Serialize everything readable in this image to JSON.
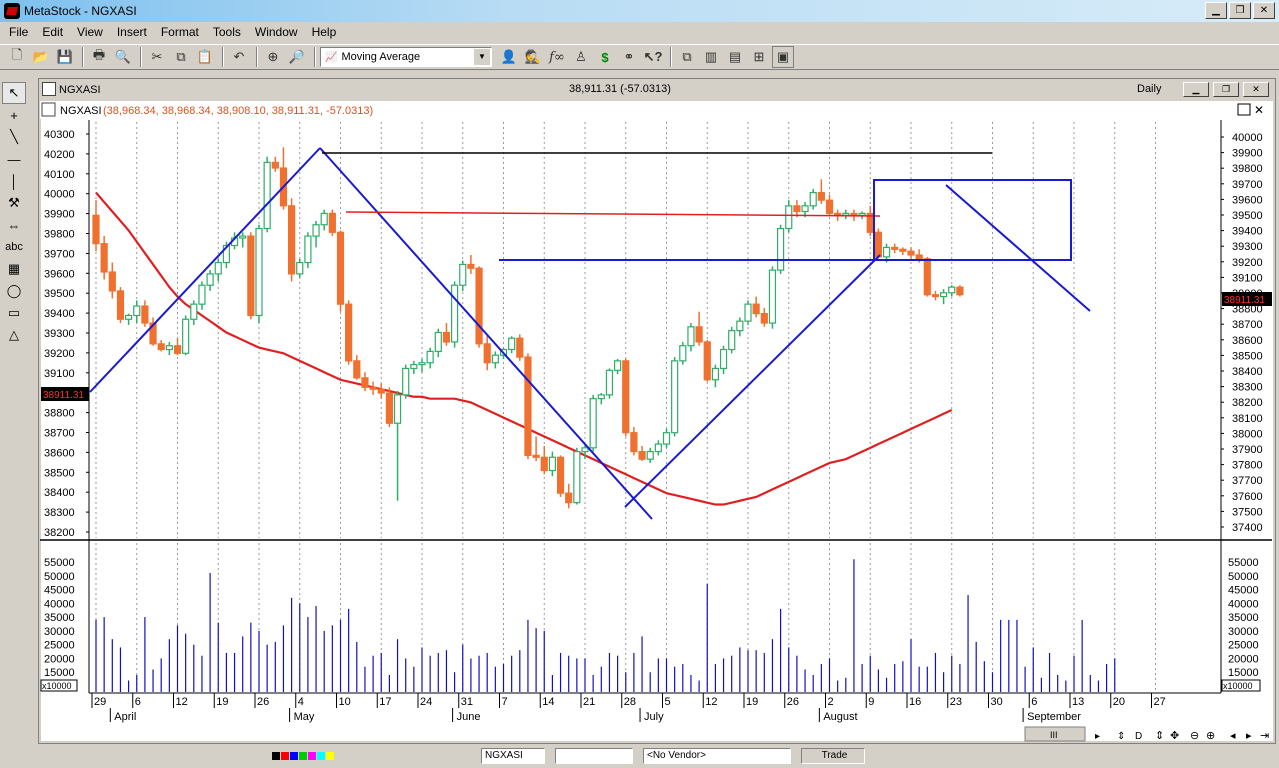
{
  "app": {
    "title": "MetaStock - NGXASI"
  },
  "menu": [
    "File",
    "Edit",
    "View",
    "Insert",
    "Format",
    "Tools",
    "Window",
    "Help"
  ],
  "toolbar": {
    "indicator_select": "Moving Average"
  },
  "left_tools": [
    "abc"
  ],
  "chart_window": {
    "ticker": "NGXASI",
    "quote": "38,911.31 (-57.0313)",
    "periodicity": "Daily",
    "header_label": "NGXASI",
    "header_values": "(38,968.34, 38,968.34, 38,908.10, 38,911.31, -57.0313)",
    "last_left": "38911.31",
    "last_right": "38911.31",
    "volume_multiplier": "x10000"
  },
  "chart_data": {
    "type": "candlestick",
    "left_axis_ticks": [
      40300,
      40200,
      40100,
      40000,
      39900,
      39800,
      39700,
      39600,
      39500,
      39400,
      39300,
      39200,
      39100,
      39000,
      38800,
      38700,
      38600,
      38500,
      38400,
      38300,
      38200
    ],
    "right_axis_ticks": [
      40000,
      39900,
      39800,
      39700,
      39600,
      39500,
      39400,
      39300,
      39200,
      39100,
      39000,
      38800,
      38700,
      38600,
      38500,
      38400,
      38300,
      38200,
      38100,
      38000,
      37900,
      37800,
      37700,
      37600,
      37500,
      37400
    ],
    "left_ylim": [
      38200,
      40300
    ],
    "volume_ticks": [
      55000,
      50000,
      45000,
      40000,
      35000,
      30000,
      25000,
      20000,
      15000,
      10000
    ],
    "volume_ylim": [
      10000,
      55000
    ],
    "x_ticks": [
      {
        "label": "29",
        "i": 0
      },
      {
        "label": "6",
        "i": 5
      },
      {
        "label": "12",
        "i": 10
      },
      {
        "label": "19",
        "i": 15
      },
      {
        "label": "26",
        "i": 20
      },
      {
        "label": "4",
        "i": 25
      },
      {
        "label": "10",
        "i": 30
      },
      {
        "label": "17",
        "i": 35
      },
      {
        "label": "24",
        "i": 40
      },
      {
        "label": "31",
        "i": 45
      },
      {
        "label": "7",
        "i": 50
      },
      {
        "label": "14",
        "i": 55
      },
      {
        "label": "21",
        "i": 60
      },
      {
        "label": "28",
        "i": 65
      },
      {
        "label": "5",
        "i": 70
      },
      {
        "label": "12",
        "i": 75
      },
      {
        "label": "19",
        "i": 80
      },
      {
        "label": "26",
        "i": 85
      },
      {
        "label": "2",
        "i": 90
      },
      {
        "label": "9",
        "i": 95
      },
      {
        "label": "16",
        "i": 100
      },
      {
        "label": "23",
        "i": 105
      },
      {
        "label": "30",
        "i": 110
      },
      {
        "label": "6",
        "i": 115
      },
      {
        "label": "13",
        "i": 120
      },
      {
        "label": "20",
        "i": 125
      },
      {
        "label": "27",
        "i": 130
      }
    ],
    "months": [
      {
        "label": "April",
        "i": 2
      },
      {
        "label": "May",
        "i": 24
      },
      {
        "label": "June",
        "i": 44
      },
      {
        "label": "July",
        "i": 67
      },
      {
        "label": "August",
        "i": 89
      },
      {
        "label": "September",
        "i": 114
      }
    ],
    "candles": [
      [
        39870,
        39950,
        39680,
        39720
      ],
      [
        39720,
        39760,
        39530,
        39570
      ],
      [
        39570,
        39620,
        39430,
        39470
      ],
      [
        39470,
        39490,
        39300,
        39320
      ],
      [
        39320,
        39350,
        39290,
        39340
      ],
      [
        39340,
        39420,
        39300,
        39390
      ],
      [
        39390,
        39420,
        39280,
        39300
      ],
      [
        39300,
        39330,
        39180,
        39190
      ],
      [
        39190,
        39210,
        39150,
        39160
      ],
      [
        39160,
        39200,
        39130,
        39180
      ],
      [
        39180,
        39220,
        39130,
        39140
      ],
      [
        39140,
        39340,
        39130,
        39320
      ],
      [
        39320,
        39420,
        39290,
        39400
      ],
      [
        39400,
        39520,
        39370,
        39500
      ],
      [
        39500,
        39580,
        39470,
        39560
      ],
      [
        39560,
        39640,
        39520,
        39620
      ],
      [
        39620,
        39730,
        39590,
        39710
      ],
      [
        39710,
        39780,
        39690,
        39750
      ],
      [
        39750,
        39780,
        39700,
        39760
      ],
      [
        39760,
        39780,
        39320,
        39340
      ],
      [
        39340,
        39820,
        39300,
        39800
      ],
      [
        39800,
        40180,
        39780,
        40150
      ],
      [
        40150,
        40180,
        40100,
        40120
      ],
      [
        40120,
        40230,
        39900,
        39920
      ],
      [
        39920,
        39960,
        39520,
        39560
      ],
      [
        39560,
        39640,
        39540,
        39620
      ],
      [
        39620,
        39780,
        39590,
        39760
      ],
      [
        39760,
        39840,
        39700,
        39820
      ],
      [
        39820,
        39900,
        39790,
        39880
      ],
      [
        39880,
        39900,
        39760,
        39780
      ],
      [
        39780,
        39790,
        39360,
        39400
      ],
      [
        39400,
        39420,
        39080,
        39100
      ],
      [
        39100,
        39130,
        39000,
        39010
      ],
      [
        39010,
        39040,
        38940,
        38960
      ],
      [
        38960,
        38990,
        38920,
        38950
      ],
      [
        38950,
        38980,
        38900,
        38930
      ],
      [
        38930,
        38960,
        38750,
        38770
      ],
      [
        38770,
        38940,
        38360,
        38920
      ],
      [
        38920,
        39080,
        38900,
        39060
      ],
      [
        39060,
        39100,
        39030,
        39080
      ],
      [
        39080,
        39110,
        39040,
        39090
      ],
      [
        39090,
        39170,
        39060,
        39150
      ],
      [
        39150,
        39270,
        39120,
        39250
      ],
      [
        39250,
        39300,
        39180,
        39200
      ],
      [
        39200,
        39520,
        39170,
        39500
      ],
      [
        39500,
        39630,
        39470,
        39610
      ],
      [
        39610,
        39660,
        39560,
        39590
      ],
      [
        39590,
        39600,
        39170,
        39190
      ],
      [
        39190,
        39230,
        39050,
        39090
      ],
      [
        39090,
        39150,
        39060,
        39130
      ],
      [
        39130,
        39170,
        39110,
        39160
      ],
      [
        39160,
        39230,
        39140,
        39220
      ],
      [
        39220,
        39240,
        39100,
        39120
      ],
      [
        39120,
        39140,
        38580,
        38600
      ],
      [
        38600,
        38700,
        38570,
        38590
      ],
      [
        38590,
        38650,
        38500,
        38520
      ],
      [
        38520,
        38620,
        38490,
        38590
      ],
      [
        38590,
        38600,
        38380,
        38400
      ],
      [
        38400,
        38450,
        38320,
        38350
      ],
      [
        38350,
        38640,
        38340,
        38620
      ],
      [
        38620,
        38660,
        38580,
        38640
      ],
      [
        38640,
        38920,
        38620,
        38900
      ],
      [
        38900,
        38930,
        38870,
        38920
      ],
      [
        38920,
        39060,
        38900,
        39050
      ],
      [
        39050,
        39110,
        39030,
        39100
      ],
      [
        39100,
        39110,
        38700,
        38720
      ],
      [
        38720,
        38750,
        38600,
        38620
      ],
      [
        38620,
        38650,
        38570,
        38580
      ],
      [
        38580,
        38640,
        38560,
        38620
      ],
      [
        38620,
        38680,
        38600,
        38660
      ],
      [
        38660,
        38740,
        38640,
        38720
      ],
      [
        38720,
        39120,
        38700,
        39100
      ],
      [
        39100,
        39200,
        39080,
        39180
      ],
      [
        39180,
        39300,
        39150,
        39280
      ],
      [
        39280,
        39360,
        39180,
        39200
      ],
      [
        39200,
        39210,
        38990,
        39000
      ],
      [
        39000,
        39080,
        38960,
        39060
      ],
      [
        39060,
        39180,
        39030,
        39160
      ],
      [
        39160,
        39280,
        39140,
        39260
      ],
      [
        39260,
        39330,
        39230,
        39310
      ],
      [
        39310,
        39420,
        39290,
        39400
      ],
      [
        39400,
        39440,
        39330,
        39350
      ],
      [
        39350,
        39380,
        39280,
        39300
      ],
      [
        39300,
        39600,
        39270,
        39580
      ],
      [
        39580,
        39820,
        39560,
        39800
      ],
      [
        39800,
        39950,
        39780,
        39920
      ],
      [
        39920,
        39950,
        39860,
        39890
      ],
      [
        39890,
        39940,
        39860,
        39920
      ],
      [
        39920,
        40010,
        39900,
        39990
      ],
      [
        39990,
        40060,
        39930,
        39950
      ],
      [
        39950,
        39980,
        39870,
        39880
      ],
      [
        39880,
        39900,
        39840,
        39870
      ],
      [
        39870,
        39900,
        39850,
        39880
      ],
      [
        39880,
        39900,
        39840,
        39870
      ],
      [
        39870,
        39890,
        39850,
        39880
      ],
      [
        39880,
        39920,
        39760,
        39780
      ],
      [
        39780,
        39800,
        39640,
        39650
      ],
      [
        39650,
        39720,
        39620,
        39700
      ],
      [
        39700,
        39720,
        39670,
        39690
      ],
      [
        39690,
        39700,
        39660,
        39680
      ],
      [
        39680,
        39700,
        39640,
        39660
      ],
      [
        39660,
        39690,
        39620,
        39640
      ],
      [
        39640,
        39650,
        39440,
        39450
      ],
      [
        39450,
        39470,
        39420,
        39440
      ],
      [
        39440,
        39480,
        39400,
        39460
      ],
      [
        39460,
        39500,
        39440,
        39490
      ],
      [
        39490,
        39500,
        39440,
        39450
      ]
    ],
    "moving_average": [
      39990,
      39940,
      39890,
      39840,
      39790,
      39730,
      39670,
      39610,
      39550,
      39490,
      39440,
      39400,
      39370,
      39340,
      39310,
      39280,
      39250,
      39230,
      39210,
      39190,
      39170,
      39160,
      39150,
      39140,
      39120,
      39100,
      39080,
      39060,
      39040,
      39020,
      39000,
      38990,
      38980,
      38970,
      38960,
      38950,
      38940,
      38930,
      38920,
      38910,
      38910,
      38900,
      38900,
      38900,
      38900,
      38890,
      38880,
      38860,
      38840,
      38820,
      38800,
      38780,
      38760,
      38740,
      38720,
      38700,
      38680,
      38660,
      38640,
      38620,
      38600,
      38580,
      38560,
      38540,
      38520,
      38500,
      38480,
      38460,
      38440,
      38420,
      38400,
      38390,
      38380,
      38370,
      38360,
      38350,
      38340,
      38340,
      38350,
      38360,
      38370,
      38380,
      38400,
      38420,
      38440,
      38460,
      38480,
      38500,
      38520,
      38540,
      38560,
      38570,
      38580,
      38600,
      38620,
      38640,
      38660,
      38680,
      38700,
      38720,
      38740,
      38760,
      38780,
      38800,
      38820,
      38840
    ],
    "volume": [
      34000,
      35000,
      27000,
      24000,
      12000,
      14000,
      35000,
      16000,
      20000,
      27000,
      32000,
      29000,
      25000,
      21000,
      51000,
      33000,
      22000,
      22000,
      28000,
      33000,
      30000,
      25000,
      26000,
      32000,
      42000,
      40000,
      35000,
      39000,
      30000,
      32000,
      34000,
      38000,
      26000,
      17000,
      21000,
      22000,
      14000,
      27000,
      20000,
      17000,
      24000,
      21000,
      22000,
      23000,
      15000,
      25000,
      20000,
      21000,
      22000,
      17000,
      18000,
      21000,
      23000,
      34000,
      31000,
      30000,
      14000,
      22000,
      21000,
      20000,
      20000,
      14000,
      17000,
      22000,
      21000,
      15000,
      22000,
      28000,
      15000,
      20000,
      20000,
      17000,
      18000,
      14000,
      12000,
      47000,
      18000,
      20000,
      21000,
      24000,
      23000,
      23000,
      22000,
      27000,
      38000,
      24000,
      21000,
      16000,
      14000,
      18000,
      20000,
      12000,
      13000,
      56000,
      18000,
      21000,
      16000,
      13000,
      18000,
      19000,
      27000,
      17000,
      17000,
      22000,
      15000,
      21000,
      18000,
      43000,
      26000,
      19000,
      15000,
      34000,
      34000,
      34000,
      17000,
      24000,
      13000,
      22000,
      14000,
      12000,
      21000,
      34000,
      14000,
      12000,
      18000,
      20000
    ]
  },
  "status": {
    "security": "NGXASI",
    "vendor": "<No Vendor>",
    "trade": "Trade"
  }
}
